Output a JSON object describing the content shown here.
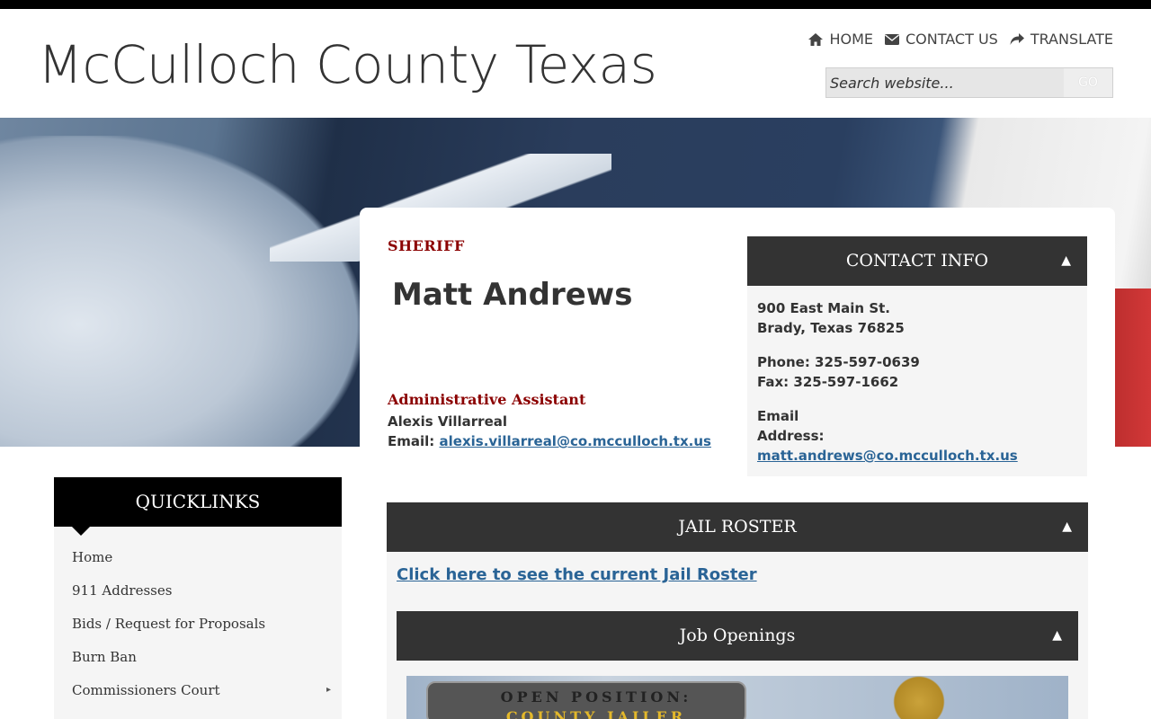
{
  "header": {
    "site_title": "McCulloch County Texas",
    "nav": [
      {
        "label": "HOME",
        "icon": "home-icon"
      },
      {
        "label": "CONTACT US",
        "icon": "envelope-icon"
      },
      {
        "label": "TRANSLATE",
        "icon": "share-arrow-icon"
      }
    ],
    "search": {
      "placeholder": "Search website...",
      "button_label": "GO"
    }
  },
  "profile": {
    "role": "SHERIFF",
    "name": "Matt Andrews",
    "assistant_title": "Administrative Assistant",
    "assistant_name": "Alexis Villarreal",
    "assistant_email_label": "Email:",
    "assistant_email": "alexis.villarreal@co.mcculloch.tx.us"
  },
  "contact": {
    "title": "CONTACT INFO",
    "toggle": "▲",
    "address_line1": "900 East Main St.",
    "address_line2": "Brady, Texas 76825",
    "phone": "Phone: 325-597-0639",
    "fax": "Fax: 325-597-1662",
    "email_label_1": "Email",
    "email_label_2": "Address:",
    "email": "matt.andrews@co.mcculloch.tx.us"
  },
  "quicklinks": {
    "title": "QUICKLINKS",
    "items": [
      {
        "label": "Home"
      },
      {
        "label": "911 Addresses"
      },
      {
        "label": "Bids / Request for Proposals"
      },
      {
        "label": "Burn Ban"
      },
      {
        "label": "Commissioners Court",
        "submenu_arrow": "▸"
      }
    ]
  },
  "jail": {
    "title": "JAIL ROSTER",
    "toggle": "▲",
    "link": "Click here to see the current Jail Roster",
    "jobs_title": "Job Openings",
    "jobs_toggle": "▲",
    "image_line1": "OPEN POSITION:",
    "image_line2": "COUNTY JAILER"
  }
}
